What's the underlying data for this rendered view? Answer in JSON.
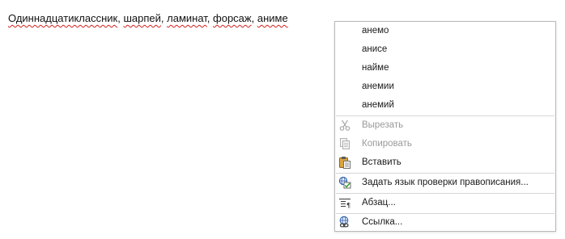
{
  "document": {
    "sentence_words": [
      {
        "text": "Одиннадцатиклассник",
        "misspelled": true
      },
      {
        "text": ", ",
        "misspelled": false
      },
      {
        "text": "шарпей",
        "misspelled": true
      },
      {
        "text": ", ",
        "misspelled": false
      },
      {
        "text": "ламинат",
        "misspelled": true
      },
      {
        "text": ", ",
        "misspelled": false
      },
      {
        "text": "форсаж",
        "misspelled": true
      },
      {
        "text": ", ",
        "misspelled": false
      },
      {
        "text": "аниме",
        "misspelled": true
      }
    ]
  },
  "context_menu": {
    "suggestions": [
      "анемо",
      "анисе",
      "найме",
      "анемии",
      "анемий"
    ],
    "cut_label": "Вырезать",
    "copy_label": "Копировать",
    "paste_label": "Вставить",
    "spellcheck_language_label": "Задать язык проверки правописания...",
    "paragraph_label": "Абзац...",
    "link_label": "Ссылка..."
  },
  "icons": {
    "cut": "scissors-icon",
    "copy": "copy-icon",
    "paste": "clipboard-paste-icon",
    "spellcheck_language": "language-check-icon",
    "paragraph": "paragraph-icon",
    "link": "link-icon"
  },
  "colors": {
    "misspelling_underline": "#d0201c",
    "disabled_text": "#9a9a9a",
    "menu_border": "#b9b9b9"
  }
}
